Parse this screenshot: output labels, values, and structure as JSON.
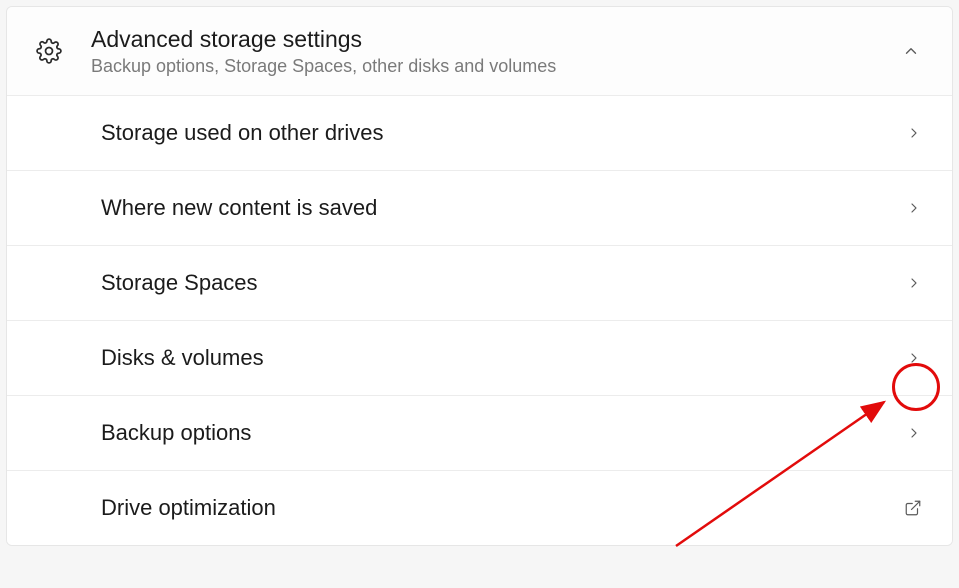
{
  "header": {
    "title": "Advanced storage settings",
    "subtitle": "Backup options, Storage Spaces, other disks and volumes"
  },
  "items": [
    {
      "label": "Storage used on other drives",
      "action": "navigate"
    },
    {
      "label": "Where new content is saved",
      "action": "navigate"
    },
    {
      "label": "Storage Spaces",
      "action": "navigate"
    },
    {
      "label": "Disks & volumes",
      "action": "navigate"
    },
    {
      "label": "Backup options",
      "action": "navigate"
    },
    {
      "label": "Drive optimization",
      "action": "external"
    }
  ],
  "annotation": {
    "highlight_item_index": 3,
    "color": "#e20b0b"
  }
}
